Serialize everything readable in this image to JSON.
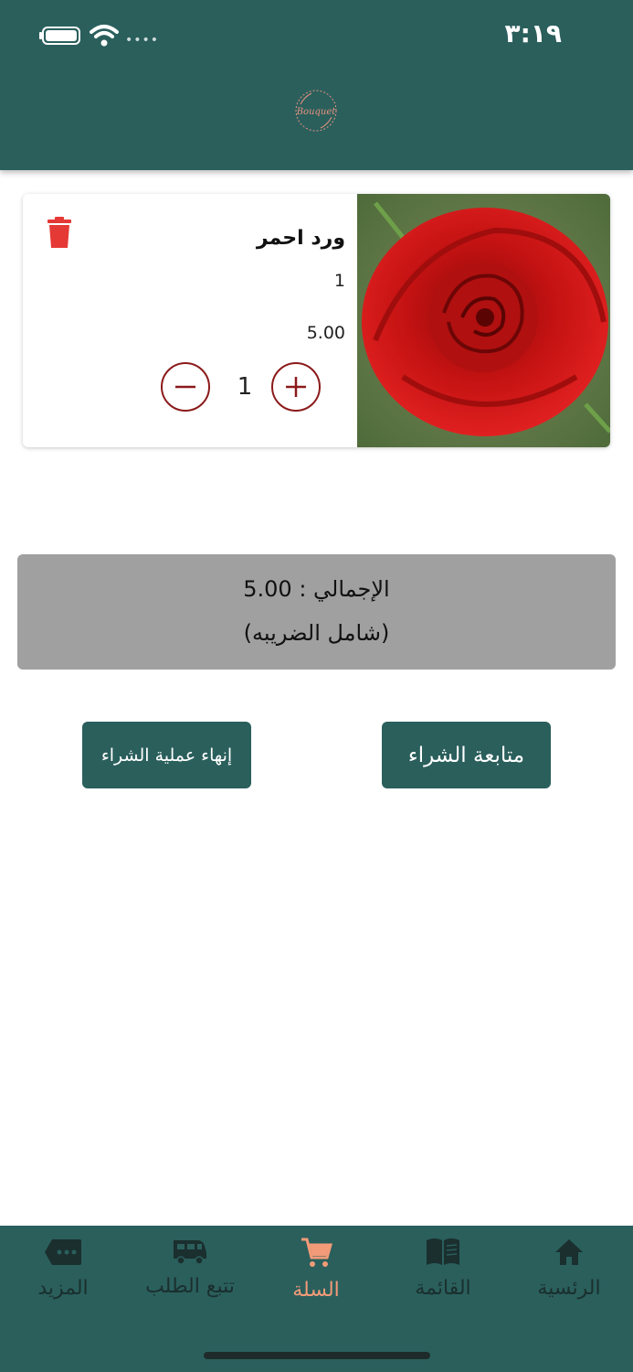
{
  "status_bar": {
    "time": "٣:١٩"
  },
  "header": {
    "logo_text": "Bouquet"
  },
  "cart": {
    "items": [
      {
        "name": "ورد احمر",
        "quantity": "1",
        "price": "5.00",
        "stepper_value": "1"
      }
    ]
  },
  "summary": {
    "total": "الإجمالي : 5.00",
    "tax_note": "(شامل الضريبه)"
  },
  "actions": {
    "checkout": "إنهاء عملية الشراء",
    "continue": "متابعة الشراء"
  },
  "tabbar": {
    "items": [
      {
        "label": "الرئسية",
        "icon": "home-icon"
      },
      {
        "label": "القائمة",
        "icon": "menu-book-icon"
      },
      {
        "label": "السلة",
        "icon": "cart-icon",
        "active": true
      },
      {
        "label": "تتبع الطلب",
        "icon": "truck-icon"
      },
      {
        "label": "المزيد",
        "icon": "more-icon"
      }
    ]
  },
  "colors": {
    "primary": "#2a5f5c",
    "accent": "#f29b78",
    "danger": "#e53935",
    "stepper": "#8b1a1a"
  }
}
